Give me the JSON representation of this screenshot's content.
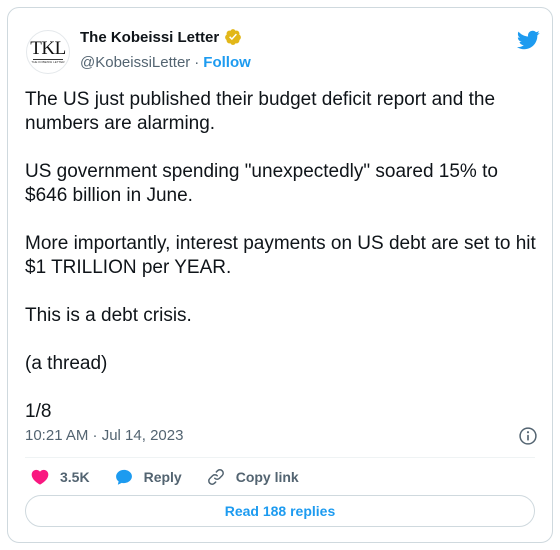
{
  "author": {
    "avatar_monogram": "TKL",
    "avatar_tagline": "THE KOBEISSI LETTER",
    "display_name": "The Kobeissi Letter",
    "handle": "@KobeissiLetter",
    "separator": "·",
    "follow_label": "Follow",
    "verified_color": "#e2b719"
  },
  "tweet": {
    "paragraphs": [
      "The US just published their budget deficit report and the numbers are alarming.",
      "US government spending \"unexpectedly\" soared 15% to $646 billion in June.",
      "More importantly, interest payments on US debt are set to hit $1 TRILLION per YEAR.",
      "This is a debt crisis.",
      "(a thread)",
      "1/8"
    ],
    "timestamp": "10:21 AM · Jul 14, 2023"
  },
  "actions": {
    "like_count": "3.5K",
    "reply_label": "Reply",
    "copy_link_label": "Copy link",
    "read_replies_label": "Read 188 replies"
  },
  "colors": {
    "brand_blue": "#1d9bf0",
    "like_red": "#f91880",
    "muted_text": "#536471",
    "border": "#cfd9de"
  },
  "icons": {
    "brand": "twitter-bird-icon",
    "verified": "verified-badge-icon",
    "info": "info-icon",
    "like": "heart-icon",
    "reply": "speech-bubble-icon",
    "copy_link": "link-icon"
  }
}
